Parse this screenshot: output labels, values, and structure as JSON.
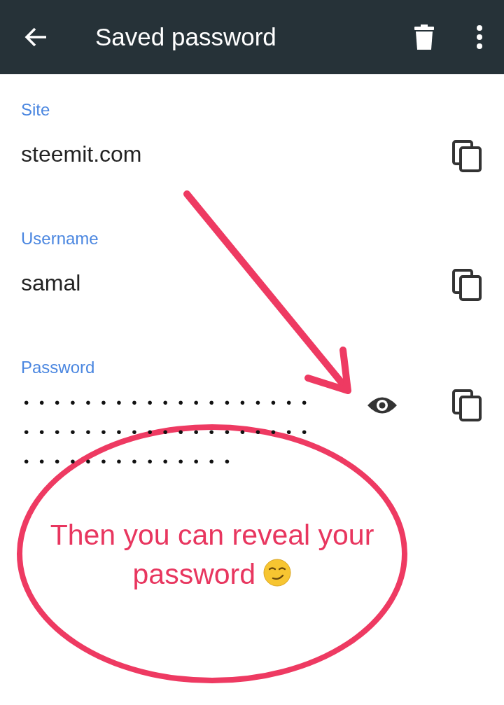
{
  "app_bar": {
    "title": "Saved password"
  },
  "fields": [
    {
      "label": "Site",
      "value": "steemit.com",
      "kind": "text"
    },
    {
      "label": "Username",
      "value": "samal",
      "kind": "text"
    },
    {
      "label": "Password",
      "value": "••••••••••••••••••••••••••••••••••••••••••••••••••••",
      "kind": "password"
    }
  ],
  "annotation": {
    "text": "Then you can reveal your password"
  }
}
